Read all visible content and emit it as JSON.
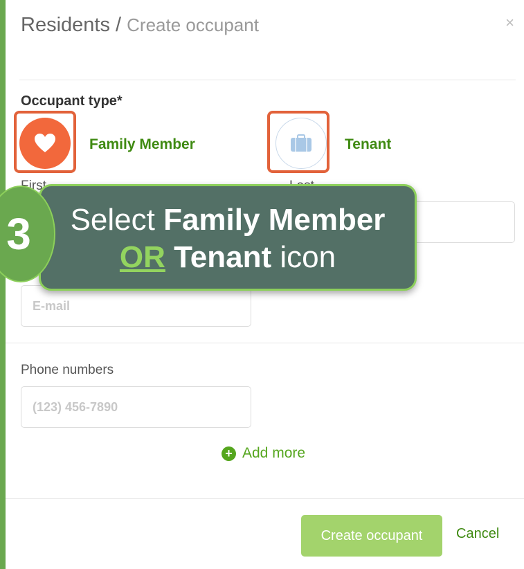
{
  "header": {
    "breadcrumb_root": "Residents",
    "breadcrumb_sep": "/",
    "breadcrumb_current": "Create occupant",
    "close_glyph": "×"
  },
  "occupant_type": {
    "label": "Occupant type*",
    "options": [
      {
        "label": "Family Member",
        "icon": "heart-icon",
        "selected": true
      },
      {
        "label": "Tenant",
        "icon": "briefcase-icon",
        "selected": false
      }
    ]
  },
  "fields": {
    "first_name_label_partial": "First",
    "last_name_label_partial": "Last",
    "email_placeholder": "E-mail",
    "phone_label": "Phone numbers",
    "phone_placeholder": "(123) 456-7890"
  },
  "add_more_label": "Add more",
  "actions": {
    "create_label": "Create occupant",
    "cancel_label": "Cancel"
  },
  "callout": {
    "step_number": "3",
    "line1_prefix": "Select ",
    "line1_bold": "Family Member",
    "line2_or": "OR",
    "line2_bold": "Tenant",
    "line2_suffix": " icon"
  },
  "colors": {
    "accent_green": "#3f8a12",
    "selected_orange": "#f2683c",
    "callout_bg": "#537066",
    "button_green": "#a3d36c"
  }
}
